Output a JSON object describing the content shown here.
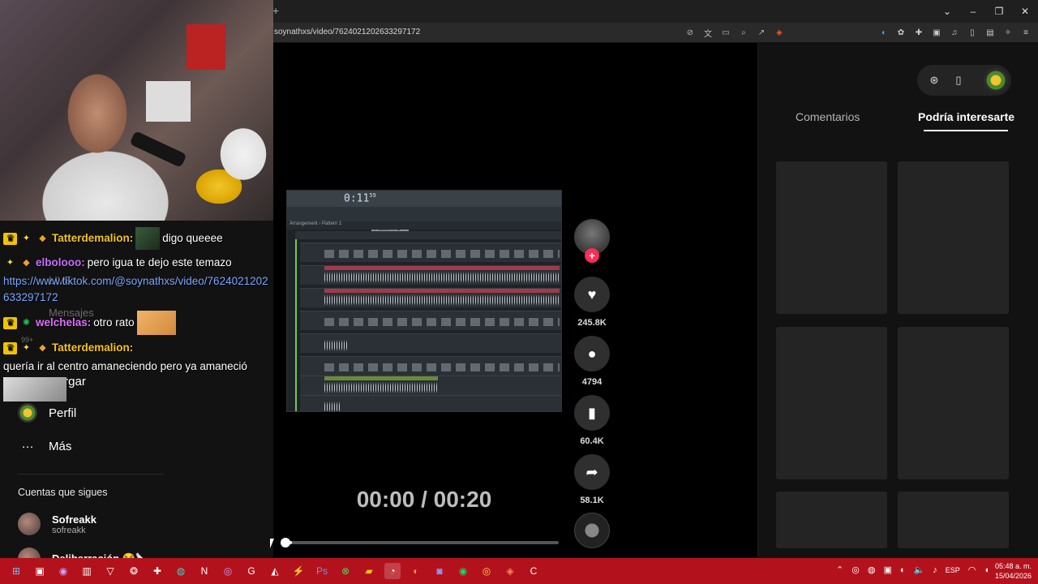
{
  "browser": {
    "new_tab": "+",
    "url": "soynathxs/video/7624021202633297172",
    "window_controls": [
      "⌄",
      "–",
      "❐",
      "✕"
    ]
  },
  "sidebar": {
    "faded_items": [
      "LIVE",
      "Mensajes",
      "99+"
    ],
    "upload_label": "Cargar",
    "profile_label": "Perfil",
    "more_label": "Más",
    "following_title": "Cuentas que sigues",
    "accounts": [
      {
        "name": "Sofreakk",
        "handle": "sofreakk"
      },
      {
        "name": "Deliberración 😭🪚...",
        "handle": ""
      }
    ]
  },
  "chat": [
    {
      "user": "Tatterdemalion:",
      "text": "digo queeee"
    },
    {
      "user": "elbolooo:",
      "text": "pero igua te dejo este temazo",
      "link": "https://www.tiktok.com/@soynathxs/video/7624021202633297172"
    },
    {
      "user": "welchelas:",
      "text": "otro rato"
    },
    {
      "user": "Tatterdemalion:",
      "text": "quería ir al centro amaneciendo pero ya amaneció"
    }
  ],
  "video": {
    "fl_time": "0:11",
    "fl_time_sub": "59",
    "fl_pattern": "Pattern 1",
    "fl_arrangement": "Arrangement › Pattern 1",
    "timecode": "00:00 / 00:20",
    "progress": 0.02
  },
  "actions": {
    "likes": "245.8K",
    "comments": "4794",
    "saves": "60.4K",
    "shares": "58.1K"
  },
  "right_panel": {
    "tab_comments": "Comentarios",
    "tab_suggested": "Podría interesarte"
  },
  "taskbar": {
    "lang": "ESP",
    "time": "05:48 a. m.",
    "date": "15/04/2026"
  }
}
